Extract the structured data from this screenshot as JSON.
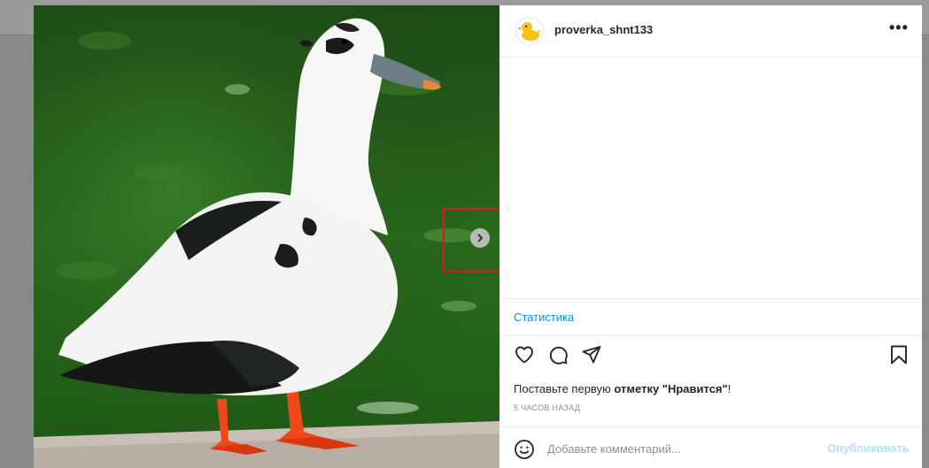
{
  "post": {
    "username": "proverka_shnt133",
    "more_label": "•••",
    "stats_label": "Статистика",
    "likes_prefix": "Поставьте первую ",
    "likes_bold": "отметку \"Нравится\"",
    "likes_suffix": "!",
    "time_ago": "5 ЧАСОВ НАЗАД",
    "comment_placeholder": "Добавьте комментарий...",
    "publish_label": "Опубликовать"
  },
  "icons": {
    "avatar": "duck-avatar-icon",
    "next": "chevron-right-icon",
    "like": "heart-icon",
    "comment": "comment-icon",
    "share": "paper-plane-icon",
    "save": "bookmark-icon",
    "emoji": "smiley-icon"
  },
  "colors": {
    "link": "#0095f6",
    "publish_disabled": "#b2dffc",
    "annotation": "#e8161b"
  }
}
